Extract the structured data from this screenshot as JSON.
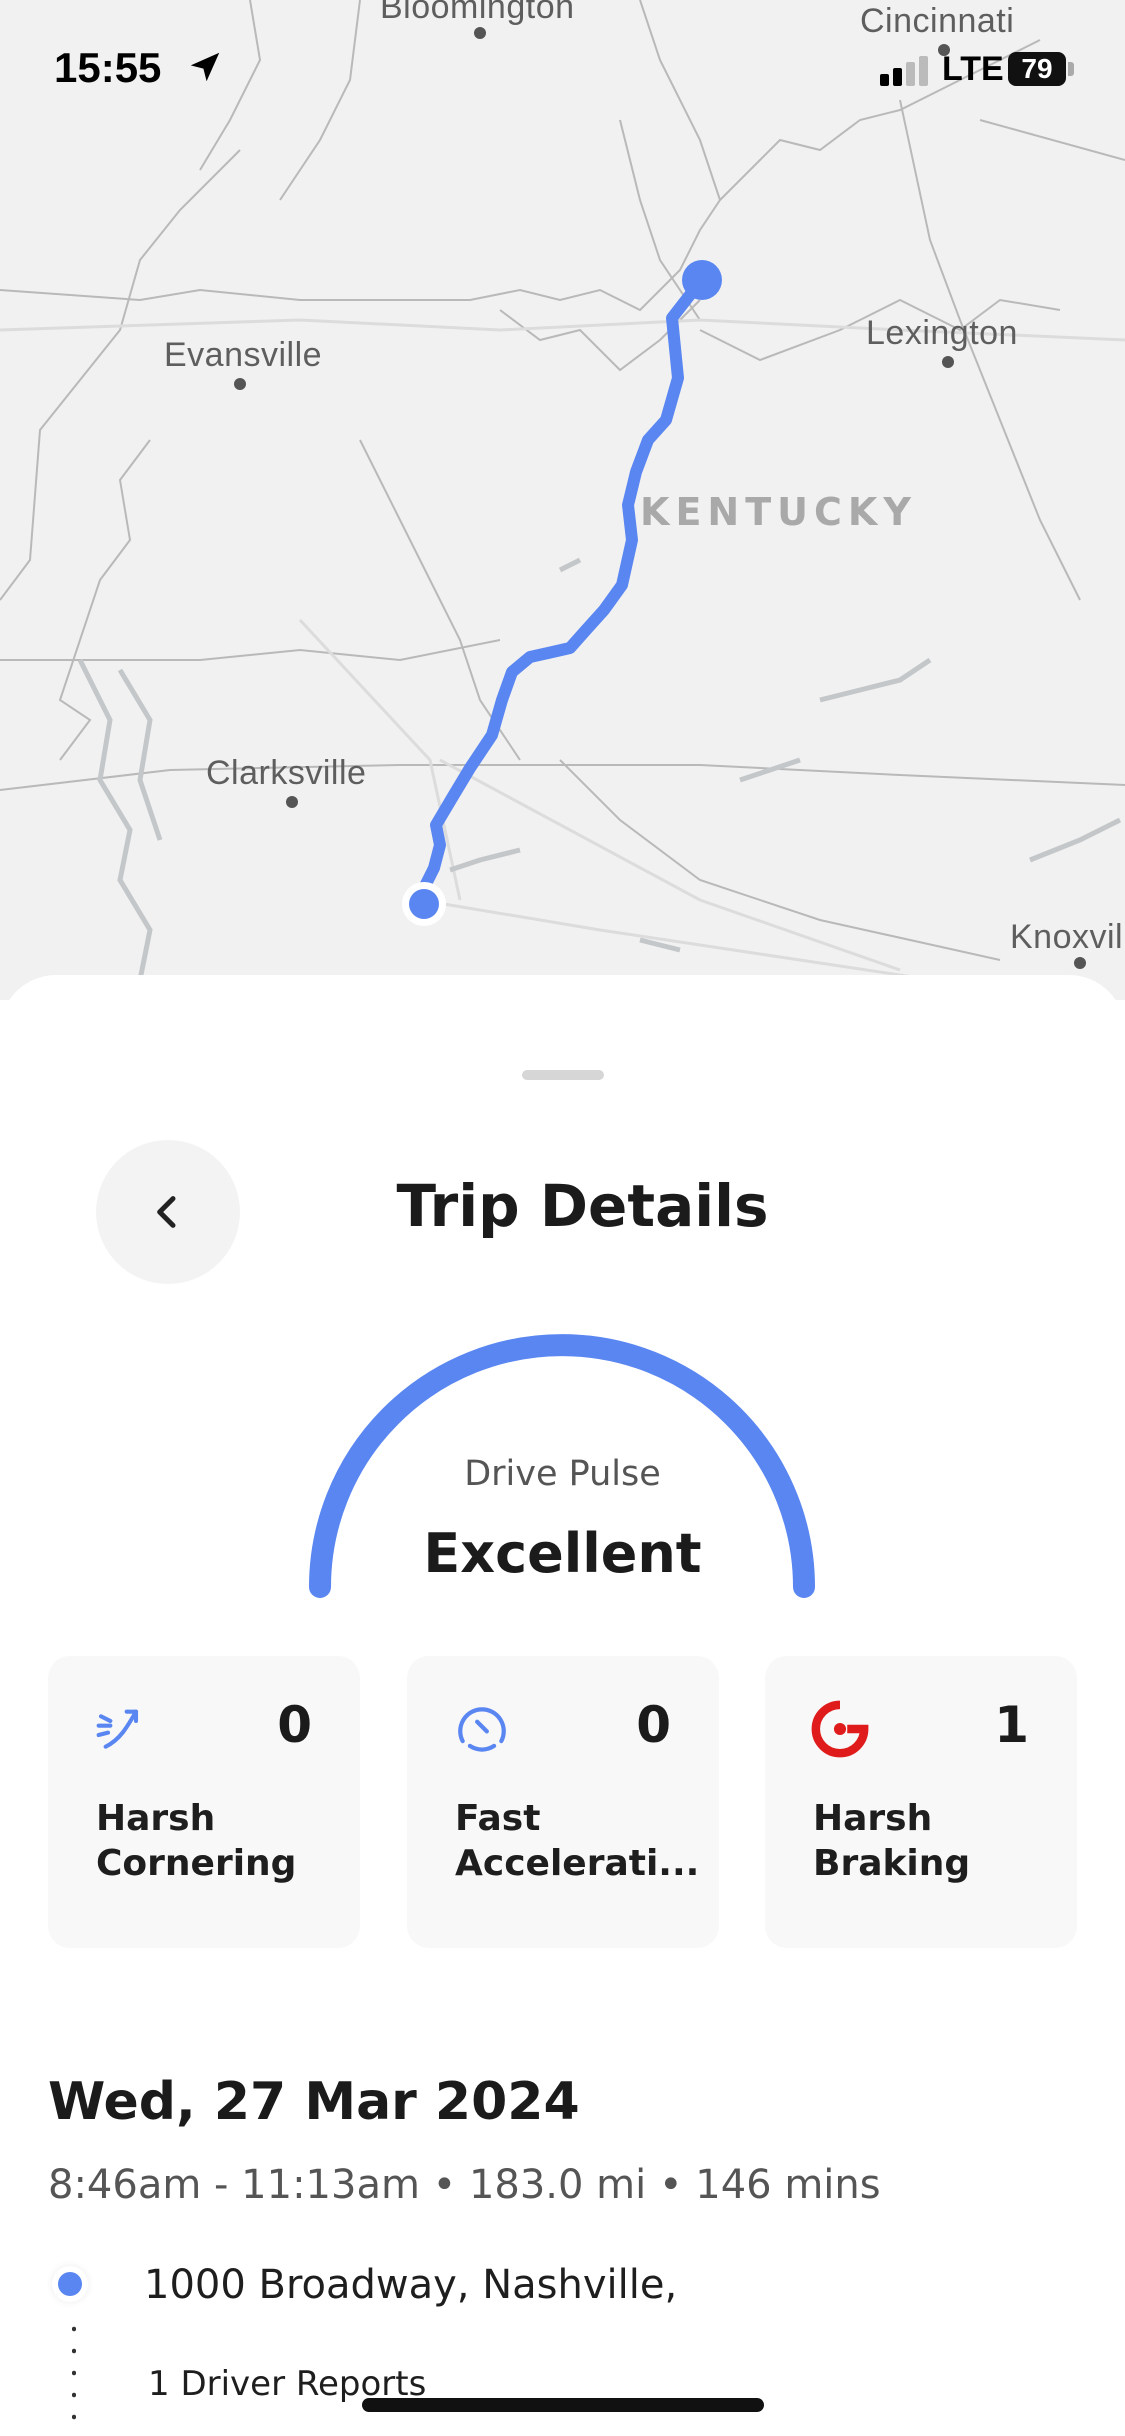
{
  "status_bar": {
    "time": "15:55",
    "network": "LTE",
    "battery": "79"
  },
  "map": {
    "cities": {
      "bloomington": "Bloomington",
      "cincinnati": "Cincinnati",
      "evansville": "Evansville",
      "lexington": "Lexington",
      "clarksville": "Clarksville",
      "knoxville": "Knoxvil"
    },
    "state": "KENTUCKY",
    "route_color": "#5a86f2"
  },
  "header": {
    "title": "Trip Details"
  },
  "drive_pulse": {
    "label": "Drive Pulse",
    "rating": "Excellent",
    "accent": "#5a86f2"
  },
  "events": [
    {
      "name": "harsh-cornering",
      "label": "Harsh\nCornering",
      "count": "0",
      "icon": "cornering-icon",
      "color": "#5a86f2"
    },
    {
      "name": "fast-acceleration",
      "label": "Fast\nAccelerati...",
      "count": "0",
      "icon": "speedometer-icon",
      "color": "#5a86f2"
    },
    {
      "name": "harsh-braking",
      "label": "Harsh\nBraking",
      "count": "1",
      "icon": "brake-icon",
      "color": "#e01b1b"
    }
  ],
  "trip": {
    "date": "Wed, 27 Mar 2024",
    "summary": "8:46am - 11:13am • 183.0 mi • 146 mins",
    "origin": "1000 Broadway, Nashville,",
    "reports": "1 Driver Reports"
  }
}
